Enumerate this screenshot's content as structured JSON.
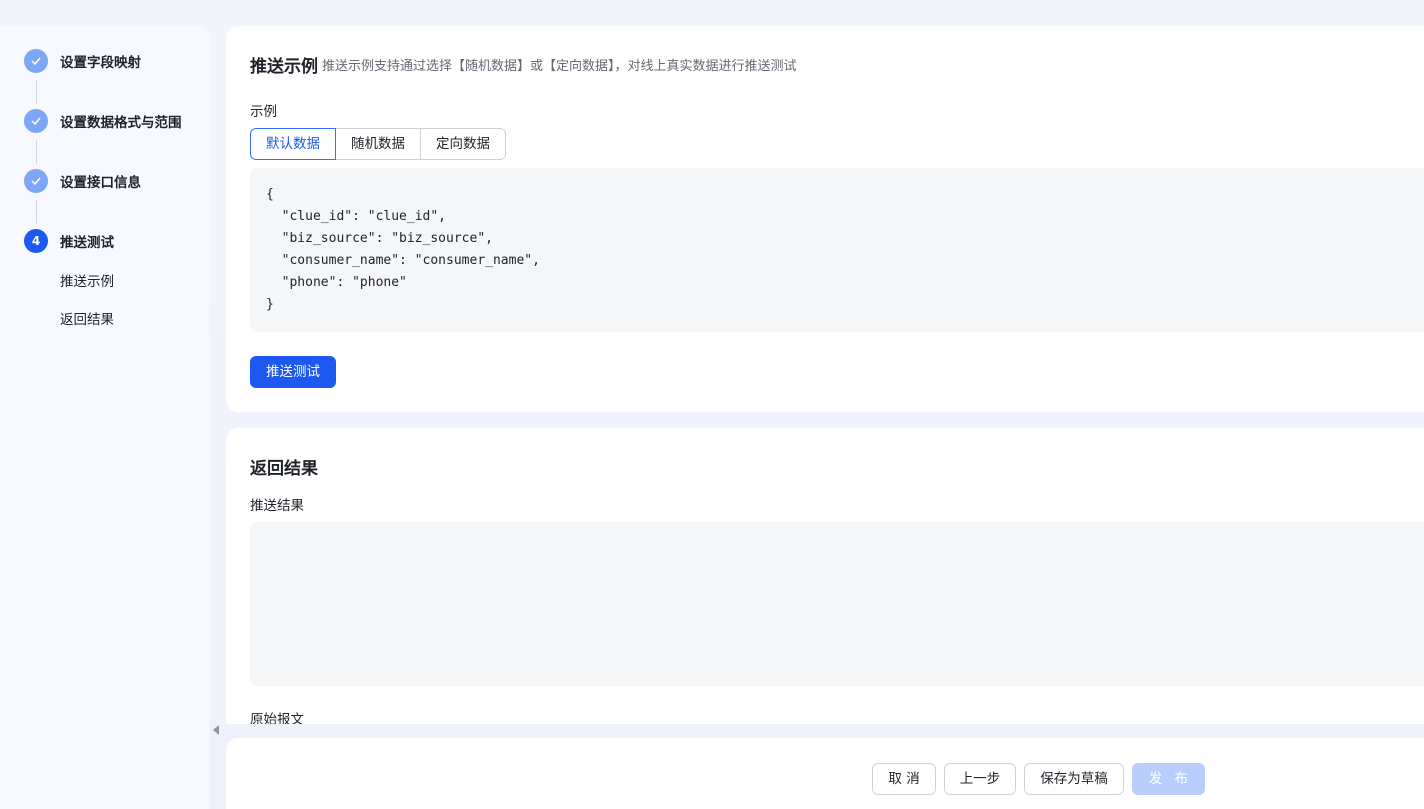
{
  "steps": [
    {
      "label": "设置字段映射",
      "state": "done"
    },
    {
      "label": "设置数据格式与范围",
      "state": "done"
    },
    {
      "label": "设置接口信息",
      "state": "done"
    },
    {
      "label": "推送测试",
      "state": "active",
      "number": "4"
    }
  ],
  "substeps": [
    "推送示例",
    "返回结果"
  ],
  "push_example": {
    "title": "推送示例",
    "description": "推送示例支持通过选择【随机数据】或【定向数据】，对线上真实数据进行推送测试",
    "field_label": "示例",
    "tabs": [
      "默认数据",
      "随机数据",
      "定向数据"
    ],
    "active_tab": "默认数据",
    "code": "{\n  \"clue_id\": \"clue_id\",\n  \"biz_source\": \"biz_source\",\n  \"consumer_name\": \"consumer_name\",\n  \"phone\": \"phone\"\n}",
    "test_button": "推送测试"
  },
  "result": {
    "title": "返回结果",
    "push_result_label": "推送结果",
    "push_result_value": "",
    "raw_message_label": "原始报文"
  },
  "footer": {
    "cancel": "取 消",
    "prev": "上一步",
    "save_draft": "保存为草稿",
    "publish": "发 布"
  },
  "colors": {
    "primary": "#1d58f0",
    "step_done": "#7ea6f6",
    "disabled_primary": "#bacefd"
  }
}
